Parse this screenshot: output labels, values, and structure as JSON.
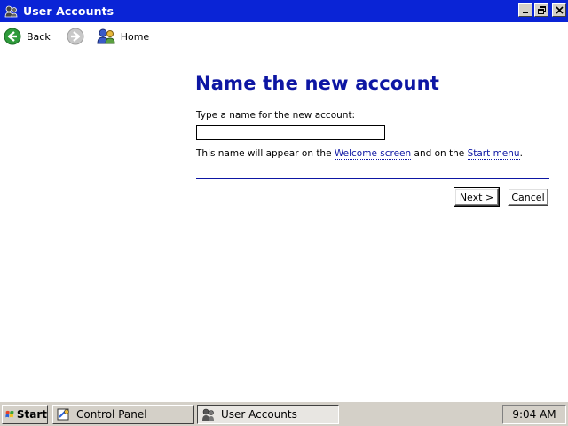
{
  "window": {
    "title": "User Accounts",
    "icon": "user-accounts-icon",
    "controls": [
      "minimize",
      "restore",
      "close"
    ]
  },
  "nav": {
    "back_label": "Back",
    "home_label": "Home",
    "back_icon": "back-arrow-icon",
    "forward_icon": "forward-arrow-icon",
    "home_icon": "users-home-icon"
  },
  "content": {
    "title": "Name the new account",
    "field_label": "Type a name for the new account:",
    "name_value": "",
    "hint_before": "This name will appear on the ",
    "hint_link1": "Welcome screen",
    "hint_middle": " and on the ",
    "hint_link2": "Start menu",
    "hint_after": "."
  },
  "buttons": {
    "next_label": "Next >",
    "cancel_label": "Cancel"
  },
  "taskbar": {
    "start_label": "Start",
    "items": [
      {
        "label": "Control Panel",
        "icon": "control-panel-icon",
        "active": false
      },
      {
        "label": "User Accounts",
        "icon": "user-accounts-icon",
        "active": true
      }
    ],
    "clock": "9:04 AM"
  },
  "colors": {
    "titlebar": "#0a24d6",
    "heading": "#0d16a3",
    "taskbar": "#d4d0c8"
  }
}
